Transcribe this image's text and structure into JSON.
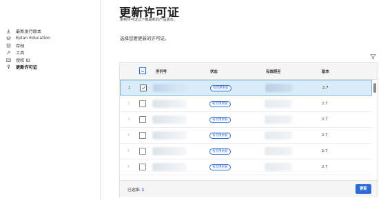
{
  "sidebar": {
    "items": [
      {
        "label": "最新发行版本",
        "icon": "download-icon"
      },
      {
        "label": "Eplan Education",
        "icon": "graduation-cap-icon"
      },
      {
        "label": "存档",
        "icon": "archive-icon"
      },
      {
        "label": "工具",
        "icon": "wrench-icon"
      },
      {
        "label": "授权 ID",
        "icon": "id-card-icon"
      },
      {
        "label": "更新许可证",
        "icon": "key-icon",
        "active": true
      }
    ]
  },
  "main": {
    "title": "更新许可证",
    "subtitle": "更新许可证以下载最新的产品版本。",
    "prompt": "选择您要更新的许可证。"
  },
  "table": {
    "columns": [
      "序列号",
      "状态",
      "有效期至",
      "版本"
    ],
    "rows": [
      {
        "index": "1",
        "checked": true,
        "status": "有可用更新",
        "version": "2.7"
      },
      {
        "index": "2",
        "checked": false,
        "status": "有可用更新",
        "version": "2.7"
      },
      {
        "index": "3",
        "checked": false,
        "status": "有可用更新",
        "version": "2.7"
      },
      {
        "index": "4",
        "checked": false,
        "status": "有可用更新",
        "version": "2.7"
      },
      {
        "index": "5",
        "checked": false,
        "status": "有可用更新",
        "version": "2.7"
      },
      {
        "index": "6",
        "checked": false,
        "status": "有可用更新",
        "version": "2.7"
      }
    ],
    "footer": {
      "selected_label": "已选择:",
      "selected_count": "1",
      "update_button": "更新"
    }
  },
  "colors": {
    "accent": "#2b6cd6",
    "selected_row": "#dbecf9"
  }
}
